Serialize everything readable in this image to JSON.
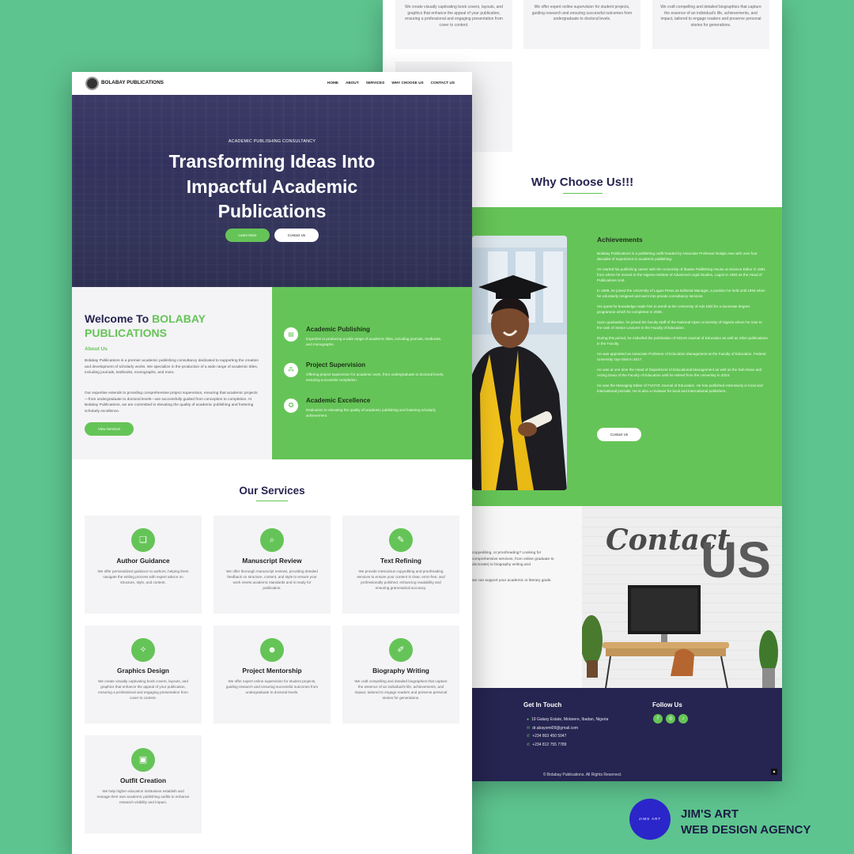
{
  "nav": {
    "logo": "BOLABAY PUBLICATIONS",
    "links": [
      "HOME",
      "ABOUT",
      "SERVICES",
      "WHY CHOOSE US",
      "CONTACT US"
    ]
  },
  "hero": {
    "eyebrow": "ACADEMIC PUBLISHING CONSULTANCY",
    "title": "Transforming Ideas Into Impactful Academic Publications",
    "btn_learn": "Learn More",
    "btn_contact": "Contact Us"
  },
  "welcome": {
    "title_prefix": "Welcome To ",
    "title_brand": "BOLABAY PUBLICATIONS",
    "about_label": "About Us",
    "p1": "Bolabay Publications is a premier academic publishing consultancy dedicated to supporting the creation and development of scholarly works. We specialize in the production of a wide range of academic titles, including journals, textbooks, monographs, and more.",
    "p2": "Our expertise extends to providing comprehensive project supervision, ensuring that academic projects—from undergraduate to doctoral levels—are successfully guided from conception to completion. At Bolabay Publications, we are committed to elevating the quality of academic publishing and fostering scholarly excellence.",
    "btn": "View Services"
  },
  "features": [
    {
      "icon": "document-icon",
      "title": "Academic Publishing",
      "desc": "Expertise in producing a wide range of academic titles, including journals, textbooks, and monographs."
    },
    {
      "icon": "network-icon",
      "title": "Project Supervision",
      "desc": "Offering project supervision for academic work, from undergraduate to doctoral levels, ensuring successful completion."
    },
    {
      "icon": "award-icon",
      "title": "Academic Excellence",
      "desc": "Dedication to elevating the quality of academic publishing and fostering scholarly achievement."
    }
  ],
  "services_title": "Our Services",
  "services": [
    {
      "icon": "book-icon",
      "title": "Author Guidance",
      "desc": "We offer personalized guidance to authors, helping them navigate the writing process with expert advice on structure, style, and content."
    },
    {
      "icon": "magnifier-icon",
      "title": "Manuscript Review",
      "desc": "We offer thorough manuscript reviews, providing detailed feedback on structure, content, and style to ensure your work meets academic standards and is ready for publication."
    },
    {
      "icon": "edit-icon",
      "title": "Text Refining",
      "desc": "We provide meticulous copyediting and proofreading services to ensure your content is clear, error-free, and professionally polished, enhancing readability and ensuring grammatical accuracy."
    },
    {
      "icon": "vector-icon",
      "title": "Graphics Design",
      "desc": "We create visually captivating book covers, layouts, and graphics that enhance the appeal of your publication, ensuring a professional and engaging presentation from cover to content."
    },
    {
      "icon": "people-icon",
      "title": "Project Mentorship",
      "desc": "We offer expert online supervision for student projects, guiding research and ensuring successful outcomes from undergraduate to doctoral levels."
    },
    {
      "icon": "pen-icon",
      "title": "Biography Writing",
      "desc": "We craft compelling and detailed biographies that capture the essence of an individual's life, achievements, and impact, tailored to engage readers and preserve personal stories for generations."
    },
    {
      "icon": "outfit-icon",
      "title": "Outfit Creation",
      "desc": "We help higher education institutions establish and manage their own academic publishing outfits to enhance research visibility and impact."
    }
  ],
  "back": {
    "top_cards": [
      "We create visually captivating book covers, layouts, and graphics that enhance the appeal of your publication, ensuring a professional and engaging presentation from cover to content.",
      "We offer expert online supervision for student projects, guiding research and ensuring successful outcomes from undergraduate to doctoral levels.",
      "We craft compelling and detailed biographies that capture the essence of an individual's life, achievements, and impact, tailored to engage readers and preserve personal stories for generations."
    ],
    "why_title": "Why Choose Us!!!",
    "ach_title": "Achievements",
    "achievements": [
      "Bolabay Publications is a publishing outfit headed by Associate Professor Bolajie Awe with over four decades of experience in academic publishing.",
      "He started his publishing career with the University of Ibadan Publishing House at Science Editor in 1981 from where he moved to the Nigeria Institute of Advanced Legal Studies, Lagos in 1983 as the Head of Publications Unit.",
      "In 1986, he joined the University of Lagos Press as Editorial Manager, a position he held until 1993 when he voluntarily resigned and went into private consultancy services.",
      "His quest for knowledge made him to enroll at the University of Ado Ekiti for a doctorate degree programme which he completed in 2006.",
      "Upon graduation, he joined the faculty staff of the National Open University of Nigeria where he rose to the rank of Senior Lecturer in the Faculty of Education.",
      "During this period, he midwifed the publication of NOUN Journal of Education as well as other publications in the Faculty.",
      "He was appointed as Associate Professor of Education Management at the Faculty of Education, Federal University Oye Ekiti in 2017.",
      "He was at one time the Head of Department of Educational Management as well as the Sub-Dean and Acting Dean of the Faculty of Education until he retired from the University in 2023.",
      "He was the Managing Editor of FUOYE Journal of Education. He has published extensively in local and international journals. He is also a reviewer for local and international publishers."
    ],
    "contact_btn": "Contact Us",
    "contact_text": [
      "copyediting, or proofreading? Looking for comprehensive services, from online graduate to doctorate) to biography writing and",
      "we can support your academic or literary goals."
    ],
    "contact_sign": "Contact US",
    "footer": {
      "get_in_touch": "Get In Touch",
      "address": "19 Galaxy Estate, Molarere, Ibadan, Nigeria",
      "email": "dr.abayomi09@gmail.com",
      "phone1": "+234 803 450 5947",
      "phone2": "+234 812 755 7789",
      "follow": "Follow Us",
      "copyright": "© Bolabay Publications. All Rights Reserved."
    }
  },
  "badge": {
    "circle": "JIMS ART",
    "line1": "JIM'S ART",
    "line2": "WEB DESIGN AGENCY"
  },
  "colors": {
    "green": "#65c457",
    "navy": "#262451",
    "background": "#5dc48f"
  }
}
